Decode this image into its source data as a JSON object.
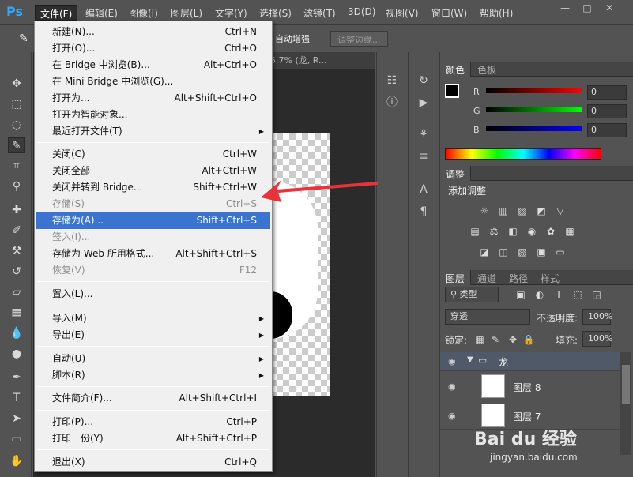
{
  "app": {
    "logo": "Ps"
  },
  "menubar": {
    "items": [
      "文件(F)",
      "编辑(E)",
      "图像(I)",
      "图层(L)",
      "文字(Y)",
      "选择(S)",
      "滤镜(T)",
      "3D(D)",
      "视图(V)",
      "窗口(W)",
      "帮助(H)"
    ],
    "window_buttons": [
      "—",
      "□",
      "✕"
    ]
  },
  "options_bar": {
    "auto_enhance": "自动增强",
    "refine_edge": "调整边缘..."
  },
  "document_tab": {
    "title": "5.7% (龙, R..."
  },
  "file_menu": {
    "items": [
      {
        "label": "新建(N)...",
        "shortcut": "Ctrl+N"
      },
      {
        "label": "打开(O)...",
        "shortcut": "Ctrl+O"
      },
      {
        "label": "在 Bridge 中浏览(B)...",
        "shortcut": "Alt+Ctrl+O"
      },
      {
        "label": "在 Mini Bridge 中浏览(G)...",
        "shortcut": ""
      },
      {
        "label": "打开为...",
        "shortcut": "Alt+Shift+Ctrl+O"
      },
      {
        "label": "打开为智能对象...",
        "shortcut": ""
      },
      {
        "label": "最近打开文件(T)",
        "shortcut": "",
        "submenu": "▶"
      },
      {
        "label": "关闭(C)",
        "shortcut": "Ctrl+W"
      },
      {
        "label": "关闭全部",
        "shortcut": "Alt+Ctrl+W"
      },
      {
        "label": "关闭并转到 Bridge...",
        "shortcut": "Shift+Ctrl+W"
      },
      {
        "label": "存储(S)",
        "shortcut": "Ctrl+S"
      },
      {
        "label": "存储为(A)...",
        "shortcut": "Shift+Ctrl+S"
      },
      {
        "label": "签入(I)...",
        "shortcut": ""
      },
      {
        "label": "存储为 Web 所用格式...",
        "shortcut": "Alt+Shift+Ctrl+S"
      },
      {
        "label": "恢复(V)",
        "shortcut": "F12"
      },
      {
        "label": "置入(L)...",
        "shortcut": ""
      },
      {
        "label": "导入(M)",
        "shortcut": "",
        "submenu": "▶"
      },
      {
        "label": "导出(E)",
        "shortcut": "",
        "submenu": "▶"
      },
      {
        "label": "自动(U)",
        "shortcut": "",
        "submenu": "▶"
      },
      {
        "label": "脚本(R)",
        "shortcut": "",
        "submenu": "▶"
      },
      {
        "label": "文件简介(F)...",
        "shortcut": "Alt+Shift+Ctrl+I"
      },
      {
        "label": "打印(P)...",
        "shortcut": "Ctrl+P"
      },
      {
        "label": "打印一份(Y)",
        "shortcut": "Alt+Shift+Ctrl+P"
      },
      {
        "label": "退出(X)",
        "shortcut": "Ctrl+Q"
      }
    ],
    "highlight_color": "#3a74d0"
  },
  "color_panel": {
    "tabs": [
      "颜色",
      "色板"
    ],
    "channels": [
      {
        "name": "R",
        "value": "0"
      },
      {
        "name": "G",
        "value": "0"
      },
      {
        "name": "B",
        "value": "0"
      }
    ]
  },
  "adjustments_panel": {
    "tab": "调整",
    "title": "添加调整"
  },
  "layers_panel": {
    "tabs": [
      "图层",
      "通道",
      "路径",
      "样式"
    ],
    "filter_kind": "类型",
    "blend_mode": "穿透",
    "opacity_label": "不透明度:",
    "opacity": "100%",
    "lock_label": "锁定:",
    "fill_label": "填充:",
    "fill": "100%",
    "group_name": "龙",
    "layers": [
      "图层 8",
      "图层 7"
    ]
  },
  "watermark": {
    "main": "Bai du 经验",
    "sub": "jingyan.baidu.com"
  }
}
